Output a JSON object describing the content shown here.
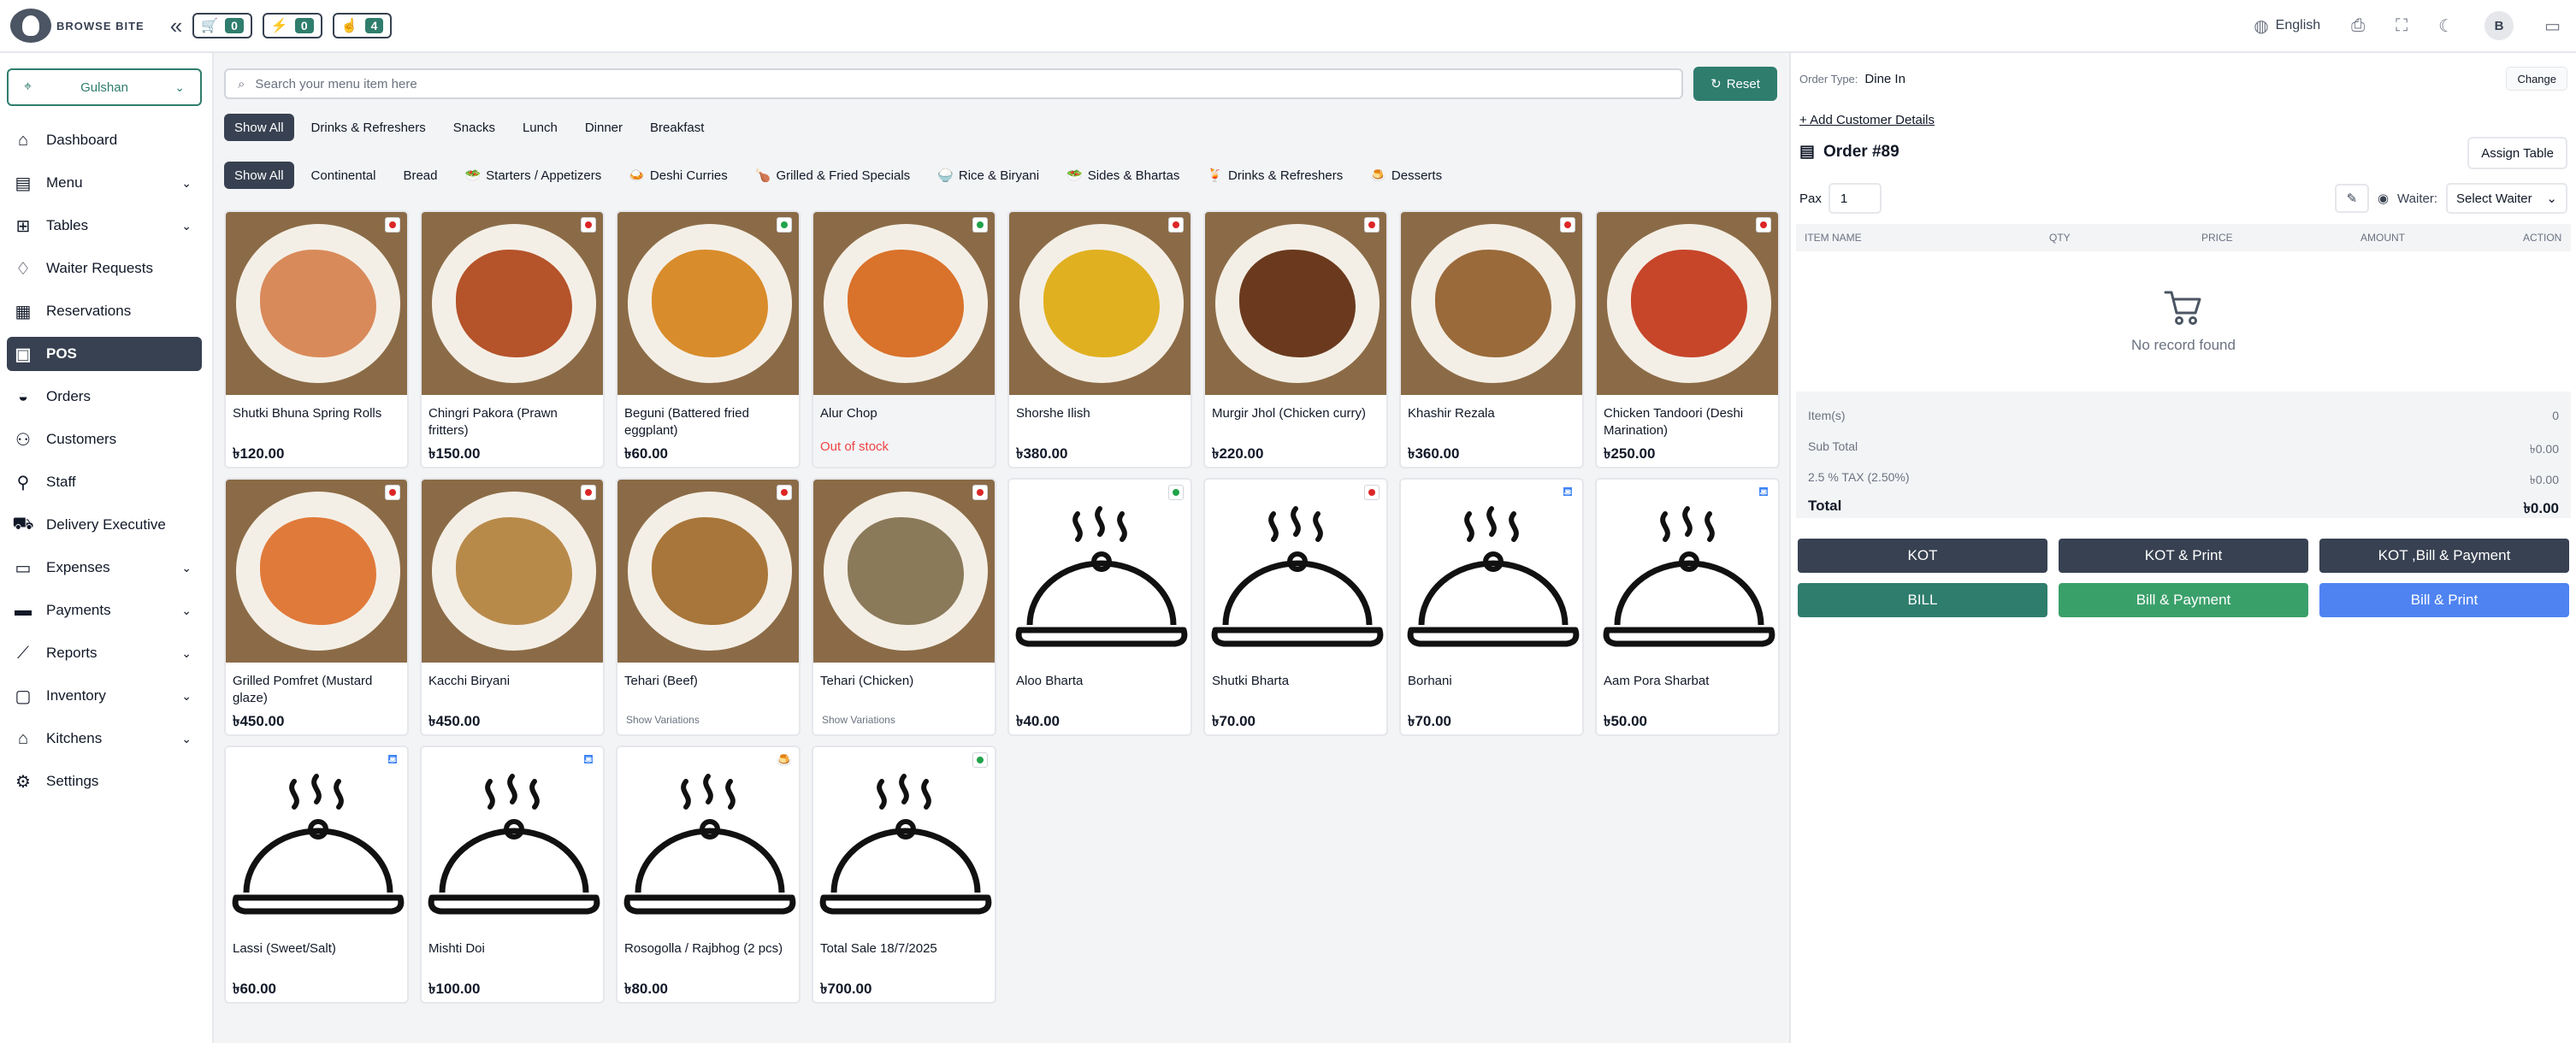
{
  "app": {
    "logo_text": "BROWSE BITE"
  },
  "topbar": {
    "counters": [
      {
        "icon": "cart-icon",
        "value": "0"
      },
      {
        "icon": "delivery-icon",
        "value": "0"
      },
      {
        "icon": "waiter-request-icon",
        "value": "4"
      }
    ],
    "language": "English",
    "user_initial": "B"
  },
  "sidebar": {
    "branch": "Gulshan",
    "items": [
      {
        "label": "Dashboard",
        "icon": "home-icon",
        "has_chevron": false,
        "active": false
      },
      {
        "label": "Menu",
        "icon": "menu-book-icon",
        "has_chevron": true,
        "active": false
      },
      {
        "label": "Tables",
        "icon": "table-icon",
        "has_chevron": true,
        "active": false
      },
      {
        "label": "Waiter Requests",
        "icon": "bell-icon",
        "has_chevron": false,
        "active": false
      },
      {
        "label": "Reservations",
        "icon": "calendar-icon",
        "has_chevron": false,
        "active": false
      },
      {
        "label": "POS",
        "icon": "pos-icon",
        "has_chevron": false,
        "active": true
      },
      {
        "label": "Orders",
        "icon": "cloche-icon",
        "has_chevron": false,
        "active": false
      },
      {
        "label": "Customers",
        "icon": "users-icon",
        "has_chevron": false,
        "active": false
      },
      {
        "label": "Staff",
        "icon": "staff-icon",
        "has_chevron": false,
        "active": false
      },
      {
        "label": "Delivery Executive",
        "icon": "delivery-bike-icon",
        "has_chevron": false,
        "active": false
      },
      {
        "label": "Expenses",
        "icon": "wallet-icon",
        "has_chevron": true,
        "active": false
      },
      {
        "label": "Payments",
        "icon": "card-icon",
        "has_chevron": true,
        "active": false
      },
      {
        "label": "Reports",
        "icon": "chart-icon",
        "has_chevron": true,
        "active": false
      },
      {
        "label": "Inventory",
        "icon": "box-icon",
        "has_chevron": true,
        "active": false
      },
      {
        "label": "Kitchens",
        "icon": "kitchen-icon",
        "has_chevron": true,
        "active": false
      },
      {
        "label": "Settings",
        "icon": "gear-icon",
        "has_chevron": false,
        "active": false
      }
    ]
  },
  "search": {
    "placeholder": "Search your menu item here",
    "reset_label": "Reset"
  },
  "meal_tabs": [
    "Show All",
    "Drinks & Refreshers",
    "Snacks",
    "Lunch",
    "Dinner",
    "Breakfast"
  ],
  "category_tabs": [
    {
      "label": "Show All",
      "emoji": ""
    },
    {
      "label": "Continental",
      "emoji": ""
    },
    {
      "label": "Bread",
      "emoji": ""
    },
    {
      "label": "Starters / Appetizers",
      "emoji": "🥗"
    },
    {
      "label": "Deshi Curries",
      "emoji": "🍛"
    },
    {
      "label": "Grilled & Fried Specials",
      "emoji": "🍗"
    },
    {
      "label": "Rice & Biryani",
      "emoji": "🍚"
    },
    {
      "label": "Sides & Bhartas",
      "emoji": "🥗"
    },
    {
      "label": "Drinks & Refreshers",
      "emoji": "🍹"
    },
    {
      "label": "Desserts",
      "emoji": "🍮"
    }
  ],
  "menu_items": [
    {
      "name": "Shutki Bhuna Spring Rolls",
      "price": "৳120.00",
      "image": "photo",
      "food_color": "#d98a5a",
      "badge": "nonveg"
    },
    {
      "name": "Chingri Pakora (Prawn fritters)",
      "price": "৳150.00",
      "image": "photo",
      "food_color": "#b5532a",
      "badge": "nonveg"
    },
    {
      "name": "Beguni (Battered fried eggplant)",
      "price": "৳60.00",
      "image": "photo",
      "food_color": "#d98c2b",
      "badge": "veg"
    },
    {
      "name": "Alur Chop",
      "price": "",
      "status": "Out of stock",
      "image": "photo",
      "food_color": "#d9722b",
      "badge": "veg"
    },
    {
      "name": "Shorshe Ilish",
      "price": "৳380.00",
      "image": "photo",
      "food_color": "#e0b020",
      "badge": "nonveg"
    },
    {
      "name": "Murgir Jhol (Chicken curry)",
      "price": "৳220.00",
      "image": "photo",
      "food_color": "#6b3a1e",
      "badge": "nonveg"
    },
    {
      "name": "Khashir Rezala",
      "price": "৳360.00",
      "image": "photo",
      "food_color": "#9a6a3a",
      "badge": "nonveg"
    },
    {
      "name": "Chicken Tandoori (Deshi Marination)",
      "price": "৳250.00",
      "image": "photo",
      "food_color": "#c7462a",
      "badge": "nonveg"
    },
    {
      "name": "Grilled Pomfret (Mustard glaze)",
      "price": "৳450.00",
      "image": "photo",
      "food_color": "#e07a3a",
      "badge": "nonveg"
    },
    {
      "name": "Kacchi Biryani",
      "price": "৳450.00",
      "image": "photo",
      "food_color": "#b88a4a",
      "badge": "nonveg"
    },
    {
      "name": "Tehari (Beef)",
      "price": "",
      "variations": "Show Variations",
      "image": "photo",
      "food_color": "#a8763a",
      "badge": "nonveg"
    },
    {
      "name": "Tehari (Chicken)",
      "price": "",
      "variations": "Show Variations",
      "image": "photo",
      "food_color": "#8a7a5a",
      "badge": "nonveg"
    },
    {
      "name": "Aloo Bharta",
      "price": "৳40.00",
      "image": "dome",
      "badge": "veg"
    },
    {
      "name": "Shutki Bharta",
      "price": "৳70.00",
      "image": "dome",
      "badge": "nonveg"
    },
    {
      "name": "Borhani",
      "price": "৳70.00",
      "image": "dome",
      "badge": "drink"
    },
    {
      "name": "Aam Pora Sharbat",
      "price": "৳50.00",
      "image": "dome",
      "badge": "drink"
    },
    {
      "name": "Lassi (Sweet/Salt)",
      "price": "৳60.00",
      "image": "dome",
      "badge": "drink"
    },
    {
      "name": "Mishti Doi",
      "price": "৳100.00",
      "image": "dome",
      "badge": "drink"
    },
    {
      "name": "Rosogolla / Rajbhog (2 pcs)",
      "price": "৳80.00",
      "image": "dome",
      "badge": "dessert"
    },
    {
      "name": "Total Sale 18/7/2025",
      "price": "৳700.00",
      "image": "dome",
      "badge": "veg"
    }
  ],
  "order_panel": {
    "order_type_label": "Order Type:",
    "order_type": "Dine In",
    "change_label": "Change",
    "add_customer": "+ Add Customer Details",
    "order_title": "Order #89",
    "assign_table": "Assign Table",
    "pax_label": "Pax",
    "pax_value": "1",
    "waiter_label": "Waiter:",
    "waiter_select": "Select Waiter",
    "columns": [
      "ITEM NAME",
      "QTY",
      "PRICE",
      "AMOUNT",
      "ACTION"
    ],
    "empty_text": "No record found",
    "summary": [
      {
        "label": "Item(s)",
        "value": "0"
      },
      {
        "label": "Sub Total",
        "value": "৳0.00"
      },
      {
        "label": "2.5 % TAX (2.50%)",
        "value": "৳0.00"
      }
    ],
    "total": {
      "label": "Total",
      "value": "৳0.00"
    },
    "buttons": [
      {
        "label": "KOT",
        "color": "#374151"
      },
      {
        "label": "KOT & Print",
        "color": "#374151"
      },
      {
        "label": "KOT ,Bill & Payment",
        "color": "#374151"
      },
      {
        "label": "BILL",
        "color": "#2f7d6d"
      },
      {
        "label": "Bill & Payment",
        "color": "#3aa06a"
      },
      {
        "label": "Bill & Print",
        "color": "#4f83f1"
      }
    ]
  }
}
